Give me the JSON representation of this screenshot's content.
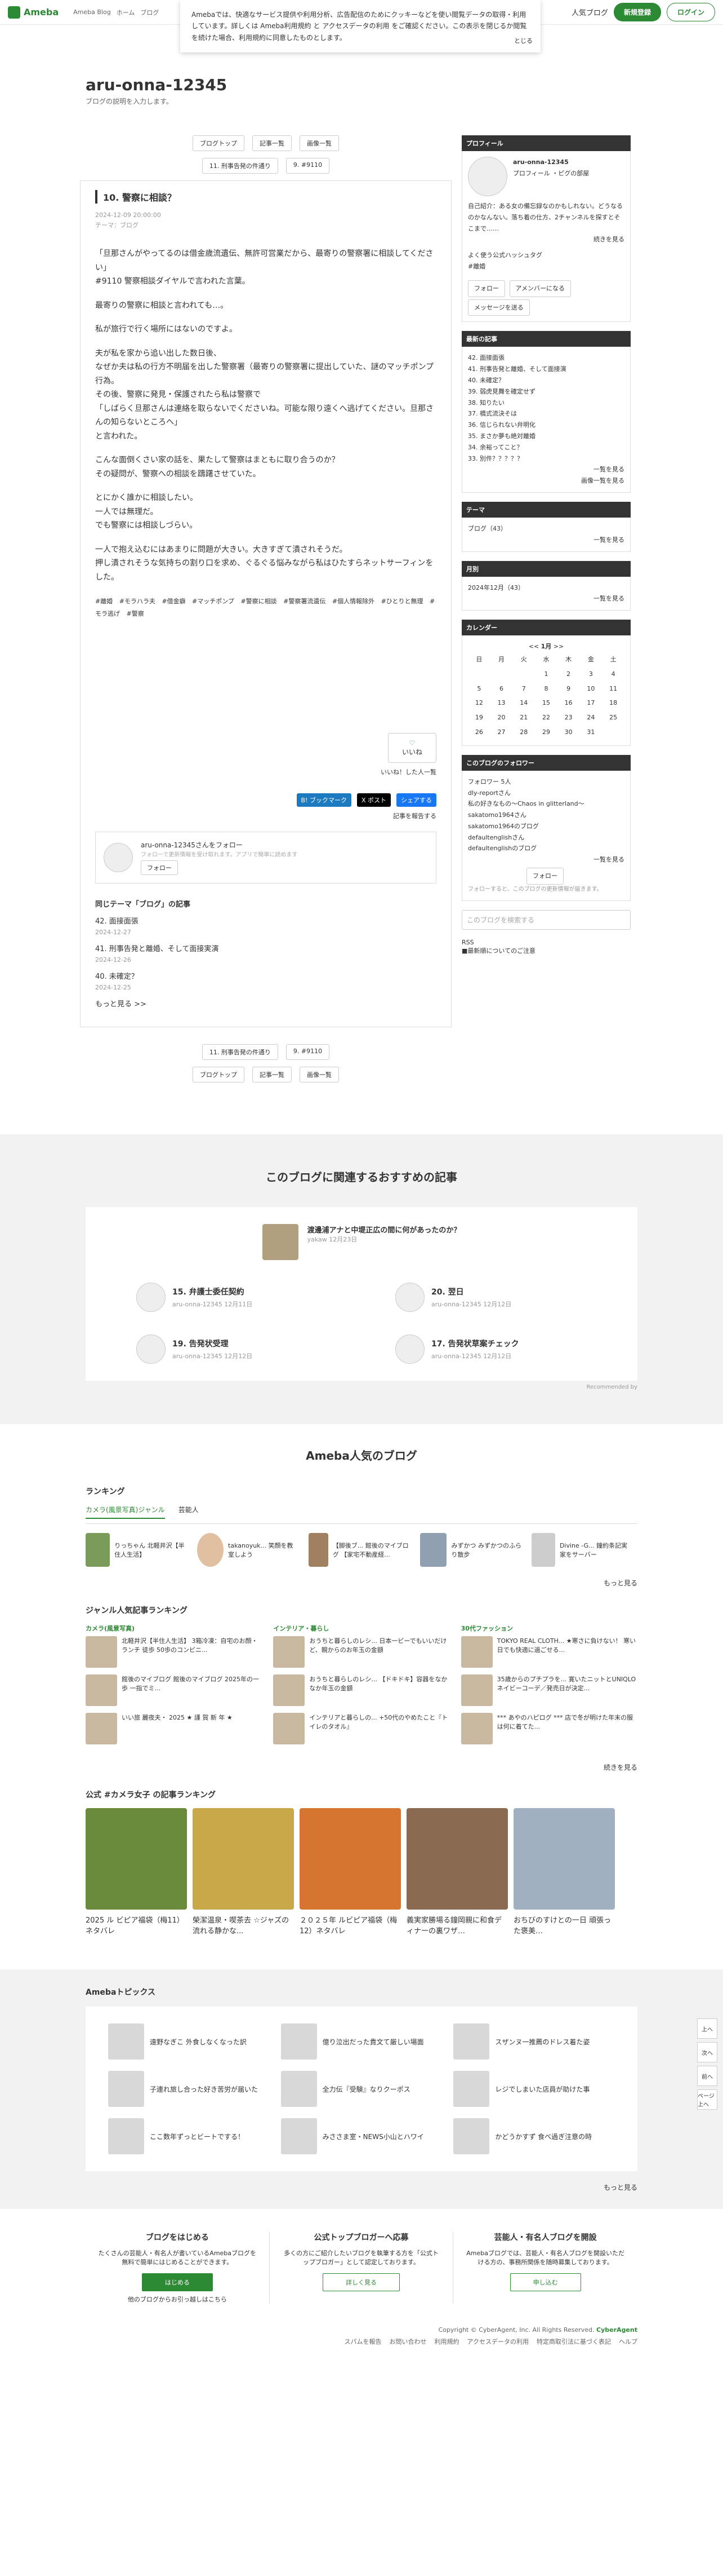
{
  "header": {
    "ameba": "Ameba",
    "blog_label": "Ameba Blog",
    "breadcrumb": [
      "ホーム",
      "ブログ"
    ],
    "top_blog": "人気ブログ",
    "signup": "新規登録",
    "login": "ログイン"
  },
  "cookie": {
    "text": "Amebaでは、快適なサービス提供や利用分析、広告配信のためにクッキーなどを使い閲覧データの取得・利用しています。詳しくは Ameba利用規約 と アクセスデータの利用 をご確認ください。この表示を閉じるか閲覧を続けた場合、利用規約に同意したものとします。",
    "close": "とじる"
  },
  "blog": {
    "title": "aru-onna-12345",
    "desc": "ブログの説明を入力します。"
  },
  "nav": {
    "top": "ブログトップ",
    "list": "記事一覧",
    "images": "画像一覧",
    "prev": "11. 刑事告発の件通り",
    "next": "9. #9110"
  },
  "article": {
    "title": "10. 警察に相談？",
    "date": "2024-12-09 20:00:00",
    "theme": "テーマ：ブログ",
    "paragraphs": [
      "「旦那さんがやってるのは借金歳流遺伝、無許可営業だから、最寄りの警察署に相談してください」\n#9110 警察相談ダイヤルで言われた言葉。",
      "最寄りの警察に相談と言われても…。",
      "私が旅行で行く場所にはないのですよ。",
      "夫が私を家から追い出した数日後、\nなぜか夫は私の行方不明届を出した警察署（最寄りの警察署に提出していた、謎のマッチポンプ行為。\nその後、警察に発見・保護されたら私は警察で\n「しばらく旦那さんは連絡を取らないでくださいね。可能な限り遠くへ逃げてください。旦那さんの知らないところへ」\nと言われた。",
      "こんな面倒くさい家の話を、果たして警察はまともに取り合うのか？\nその疑問が、警察への相談を躊躇させていた。",
      "とにかく誰かに相談したい。\n一人では無理だ。\nでも警察には相談しづらい。",
      "一人で抱え込むにはあまりに問題が大きい。大きすぎて潰されそうだ。\n押し潰されそうな気持ちの割り口を求め、ぐるぐる悩みながら私はひたすらネットサーフィンをした。"
    ],
    "tags": [
      "#離婚",
      "#モラハラ夫",
      "#借金癖",
      "#マッチポンプ",
      "#警察に相談",
      "#警察署流遺伝",
      "#個人情報除外",
      "#ひとりと無理",
      "#モラ逃げ",
      "#警察"
    ],
    "iine": "いいね",
    "iine_list": "いいね！した人一覧",
    "share": [
      "B! ブックマーク",
      "X ポスト",
      "シェアする"
    ],
    "report": "記事を報告する"
  },
  "follow_card": {
    "name": "aru-onna-12345さんをフォロー",
    "sub": "フォローで更新情報を受け取れます。アプリで簡単に読めます",
    "btn": "フォロー"
  },
  "related": {
    "title": "同じテーマ「ブログ」の記事",
    "items": [
      {
        "title": "42. 面接面張",
        "date": "2024-12-27"
      },
      {
        "title": "41. 刑事告発と離婚、そして面接実演",
        "date": "2024-12-26"
      },
      {
        "title": "40. 未確定？",
        "date": "2024-12-25"
      }
    ],
    "more": "もっと見る >>"
  },
  "side": {
    "profile_h": "プロフィール",
    "profile_name": "aru-onna-12345",
    "profile_links": "プロフィール ・ピグの部屋",
    "profile_text": "自己紹介：ある女の備忘録なのかもしれない。どうなるのかなんない。落ち着の仕方、2チャンネルを探すとそこまで……",
    "more": "続きを見る",
    "fav": "よく使う公式ハッシュタグ",
    "fav_tag": "#離婚",
    "follow": "フォロー",
    "ameba_member": "アメンバーになる",
    "message": "メッセージを送る",
    "latest_h": "最新の記事",
    "latest": [
      "42. 面接面張",
      "41. 刑事告発と離婚、そして面接演",
      "40. 未確定？",
      "39. 弱虎見舞を確定せず",
      "38. 知りたい",
      "37. 橋式流決そは",
      "36. 信じられない弁明化",
      "35. まさか夢も絶対離婚",
      "34. 余裕ってこと？",
      "33. 別件？？？？？"
    ],
    "latest_more": "一覧を見る",
    "latest_img": "画像一覧を見る",
    "theme_h": "テーマ",
    "theme": "ブログ（43）",
    "month_h": "月別",
    "month": "2024年12月（43）",
    "cal_h": "カレンダー",
    "cal_month": "1月",
    "cal_days": [
      "日",
      "月",
      "火",
      "水",
      "木",
      "金",
      "土"
    ],
    "cal_rows": [
      [
        "",
        "",
        "",
        "1",
        "2",
        "3",
        "4"
      ],
      [
        "5",
        "6",
        "7",
        "8",
        "9",
        "10",
        "11"
      ],
      [
        "12",
        "13",
        "14",
        "15",
        "16",
        "17",
        "18"
      ],
      [
        "19",
        "20",
        "21",
        "22",
        "23",
        "24",
        "25"
      ],
      [
        "26",
        "27",
        "28",
        "29",
        "30",
        "31",
        ""
      ]
    ],
    "follower_h": "このブログのフォロワー",
    "follower_count": "フォロワー 5人",
    "followers": [
      "dly-reportさん",
      "私の好きなもの〜Chaos in glitterland〜",
      "sakatomo1964さん",
      "sakatomo1964のブログ",
      "defaultenglishさん",
      "defaultenglishのブログ"
    ],
    "follower_note": "フォローすると、このブログの更新情報が届きます。",
    "search": "このブログを検索する",
    "rss": "RSS",
    "rss_note": "■最新順についてのご注意"
  },
  "reco": {
    "title": "このブログに関連するおすすめの記事",
    "top": {
      "title": "渡邊浦アナと中堤正広の間に何があったのか？",
      "meta": "yakaw  12月23日"
    },
    "items": [
      {
        "title": "15. 弁護士委任契約",
        "meta": "aru-onna-12345  12月11日"
      },
      {
        "title": "20. 翌日",
        "meta": "aru-onna-12345  12月12日"
      },
      {
        "title": "19. 告発状受理",
        "meta": "aru-onna-12345  12月12日"
      },
      {
        "title": "17. 告発状草案チェック",
        "meta": "aru-onna-12345  12月12日"
      }
    ],
    "rec_by": "Recommended by"
  },
  "popular": {
    "title": "Ameba人気のブログ",
    "ranking": "ランキング",
    "tabs": [
      "カメラ(風景写真)ジャンル",
      "芸能人"
    ],
    "rank": [
      "りっちゃん 北軽井沢【半住人生活】",
      "takanoyuk... 笑顔を教室しよう",
      "【脚後ブ... 館後のマイブログ 【家宅不動産経...",
      "みずかつ みずかつのふらり散步",
      "Divine -G... 鐘約条記実家をサーバー"
    ],
    "more": "もっと見る",
    "genre_title": "ジャンル人気記事ランキング",
    "genre": [
      {
        "name": "カメラ(風景写真)",
        "items": [
          "北軽井沢【半住人生活】 3箱冷凍：自宅のお顔・ランチ 徒歩 50歩のコンビニ...",
          "館後のマイブログ 館後のマイブログ 2025年の一歩 一指でミ...",
          "いい旅 麗夜夫・ 2025 ★ 謹 賀 新 年 ★"
        ]
      },
      {
        "name": "インテリア・暮らし",
        "items": [
          "おうちと暮らしのレシ... 日本一ビーでもいいだけど、親からのお年玉の金額",
          "おうちと暮らしのレシ... 【ドキドキ】容器をなかなか年玉の金額",
          "インテリアと暮らしの... +50代のやめたこと『トイレのタオル』"
        ]
      },
      {
        "name": "30代ファッション",
        "items": [
          "TOKYO REAL CLOTH... ★寒さに負けない！ 寒い日でも快適に過ごせる...",
          "35歳からのプチプラを... 寛いたニットとUNIQLOネイビーコーデ／発売日が決定...",
          "*** あやのハピログ *** 店で冬が明けた年末の服は何に着てた..."
        ]
      }
    ],
    "genre_more": "続きを見る",
    "camera_title": "公式 #カメラ女子 の記事ランキング",
    "photos": [
      "2025 ル ビピア福袋（梅11）ネタバレ",
      "榮潔温泉・喫茶去 ☆ジャズの流れる静かな...",
      "２０２５年 ルビピア福袋（梅12）ネタバレ",
      "義実家勝場る鐘岡親に和食ディナーの裏ワザ…",
      "おちびのすけとの一日 頑張った褒美…"
    ],
    "photo_colors": [
      "#6a8a3c",
      "#c9a84a",
      "#d67530",
      "#8a6a50",
      "#a0b0c0"
    ]
  },
  "topics": {
    "title": "Amebaトピックス",
    "items": [
      "遠野なぎこ 外食しなくなった訳",
      "億り泣出だった貴文て厳しい場面",
      "スザンヌ一推薦のドレス着た姿",
      "子連れ旅し合った好き苦労が届いた",
      "全力伝『受験』なりクーポス",
      "レジでしまいた店員が助けた事",
      "ここ数年ずっとビートでする！",
      "みささま室・NEWS小山とハワイ",
      "かどうかすず 食べ過ぎ注意の時"
    ],
    "more": "もっと見る"
  },
  "cta": [
    {
      "title": "ブログをはじめる",
      "text": "たくさんの芸能人・有名人が書いているAmebaブログを無料で簡単にはじめることができます。",
      "btn": "はじめる",
      "sub": "他のブログからお引っ越しはこちら"
    },
    {
      "title": "公式トップブロガーへ応募",
      "text": "多くの方にご紹介したいブログを執筆する方を「公式トップブロガー」として認定しております。",
      "btn": "詳しく見る",
      "sub": ""
    },
    {
      "title": "芸能人・有名人ブログを開設",
      "text": "Amebaブログでは、芸能人・有名人ブログを開設いただける方の、事務所関係を随時募集しております。",
      "btn": "申し込む",
      "sub": ""
    }
  ],
  "footer": {
    "copy": "Copyright © CyberAgent, Inc. All Rights Reserved.",
    "brand": "CyberAgent",
    "links": [
      "スパムを報告",
      "お問い合わせ",
      "利用規約",
      "アクセスデータの利用",
      "特定商取引法に基づく表記",
      "ヘルプ"
    ]
  },
  "rightnav": [
    "上へ",
    "次へ",
    "前へ",
    "ページ上へ"
  ]
}
